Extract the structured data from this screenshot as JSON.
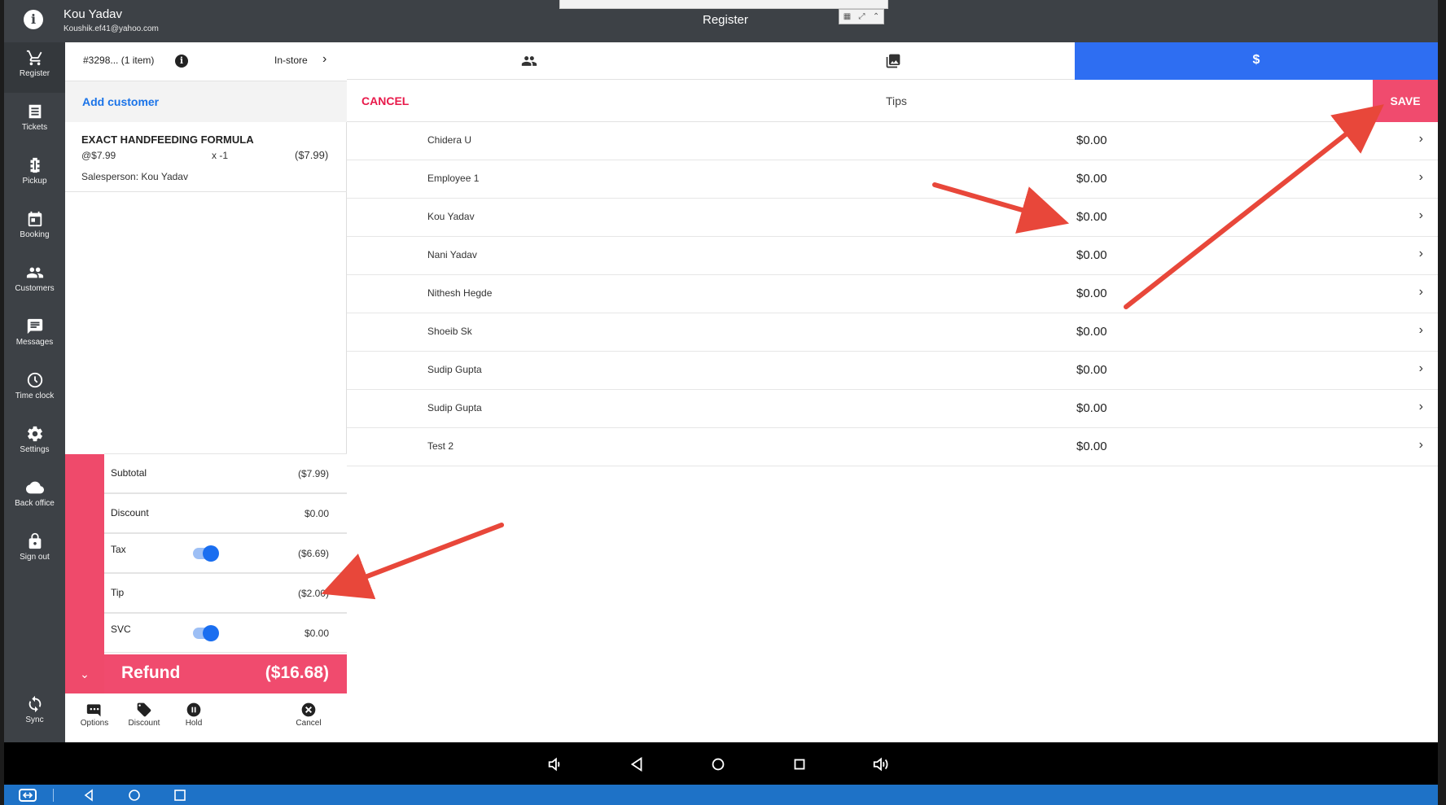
{
  "topbar": {
    "user_name": "Kou Yadav",
    "user_email": "Koushik.ef41@yahoo.com",
    "title": "Register"
  },
  "nav": {
    "items": [
      {
        "label": "Register",
        "icon": "cart-icon"
      },
      {
        "label": "Tickets",
        "icon": "tickets-icon"
      },
      {
        "label": "Pickup",
        "icon": "pickup-icon"
      },
      {
        "label": "Booking",
        "icon": "calendar-icon"
      },
      {
        "label": "Customers",
        "icon": "people-icon"
      },
      {
        "label": "Messages",
        "icon": "message-icon"
      },
      {
        "label": "Time clock",
        "icon": "clock-icon"
      },
      {
        "label": "Settings",
        "icon": "gear-icon"
      },
      {
        "label": "Back office",
        "icon": "cloud-icon"
      },
      {
        "label": "Sign out",
        "icon": "lock-icon"
      }
    ],
    "sync_label": "Sync"
  },
  "ticket": {
    "number": "#3298... (1 item)",
    "mode": "In-store",
    "add_customer": "Add customer",
    "item": {
      "name": "EXACT HANDFEEDING FORMULA",
      "unit_price": "@$7.99",
      "qty": "x  -1",
      "total": "($7.99)",
      "salesperson": "Salesperson: Kou Yadav"
    },
    "totals": {
      "subtotal_label": "Subtotal",
      "subtotal": "($7.99)",
      "discount_label": "Discount",
      "discount": "$0.00",
      "tax_label": "Tax",
      "tax": "($6.69)",
      "tip_label": "Tip",
      "tip": "($2.00)",
      "svc_label": "SVC",
      "svc": "$0.00"
    },
    "refund_label": "Refund",
    "refund_amount": "($16.68)",
    "actions": {
      "options": "Options",
      "discount": "Discount",
      "hold": "Hold",
      "cancel": "Cancel"
    }
  },
  "tips": {
    "tab_dollar": "$",
    "cancel": "CANCEL",
    "title": "Tips",
    "save": "SAVE",
    "employees": [
      {
        "name": "Chidera U",
        "tip": "$0.00"
      },
      {
        "name": "Employee 1",
        "tip": "$0.00"
      },
      {
        "name": "Kou Yadav",
        "tip": "$0.00"
      },
      {
        "name": "Nani Yadav",
        "tip": "$0.00"
      },
      {
        "name": "Nithesh Hegde",
        "tip": "$0.00"
      },
      {
        "name": "Shoeib Sk",
        "tip": "$0.00"
      },
      {
        "name": "Sudip Gupta",
        "tip": "$0.00"
      },
      {
        "name": "Sudip Gupta",
        "tip": "$0.00"
      },
      {
        "name": "Test 2",
        "tip": "$0.00"
      }
    ]
  },
  "colors": {
    "accent_pink": "#f04b6e",
    "tab_blue": "#2e6ef2",
    "nav_dark": "#3d4146",
    "link_blue": "#1a73e8",
    "annotation_red": "#e8473a"
  }
}
